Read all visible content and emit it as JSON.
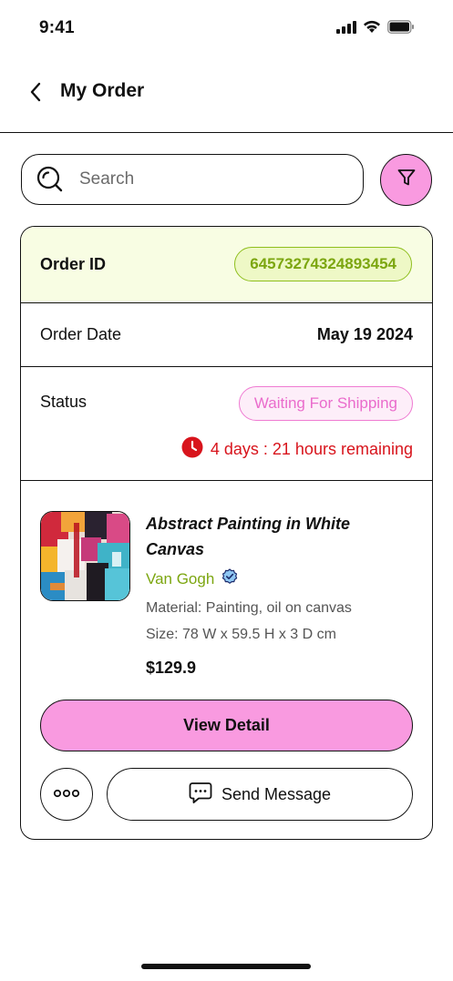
{
  "status_bar": {
    "time": "9:41"
  },
  "header": {
    "title": "My Order",
    "back_icon": "chevron-left-icon"
  },
  "search": {
    "placeholder": "Search",
    "value": "",
    "icon": "search-icon"
  },
  "filter": {
    "icon": "filter-icon",
    "color": "#f99ae0"
  },
  "order": {
    "id_label": "Order ID",
    "id_value": "64573274324893454",
    "date_label": "Order Date",
    "date_value": "May 19 2024",
    "status_label": "Status",
    "status_value": "Waiting For Shipping",
    "remaining_text": "4 days : 21 hours remaining",
    "remaining_icon": "clock-icon"
  },
  "product": {
    "name": "Abstract Painting in White Canvas",
    "artist": "Van Gogh",
    "verified_icon": "verified-badge-icon",
    "material": "Material: Painting, oil on canvas",
    "size": "Size: 78 W x 59.5 H x 3 D cm",
    "price": "$129.9"
  },
  "actions": {
    "view_detail": "View Detail",
    "send_message": "Send Message",
    "more_icon": "more-horizontal-icon",
    "message_icon": "chat-bubble-icon"
  },
  "colors": {
    "accent_pink": "#f99ae0",
    "id_green": "#7ca610",
    "id_bg": "#f8fde3",
    "status_pink": "#ea6ccc",
    "warning_red": "#d8141c"
  }
}
